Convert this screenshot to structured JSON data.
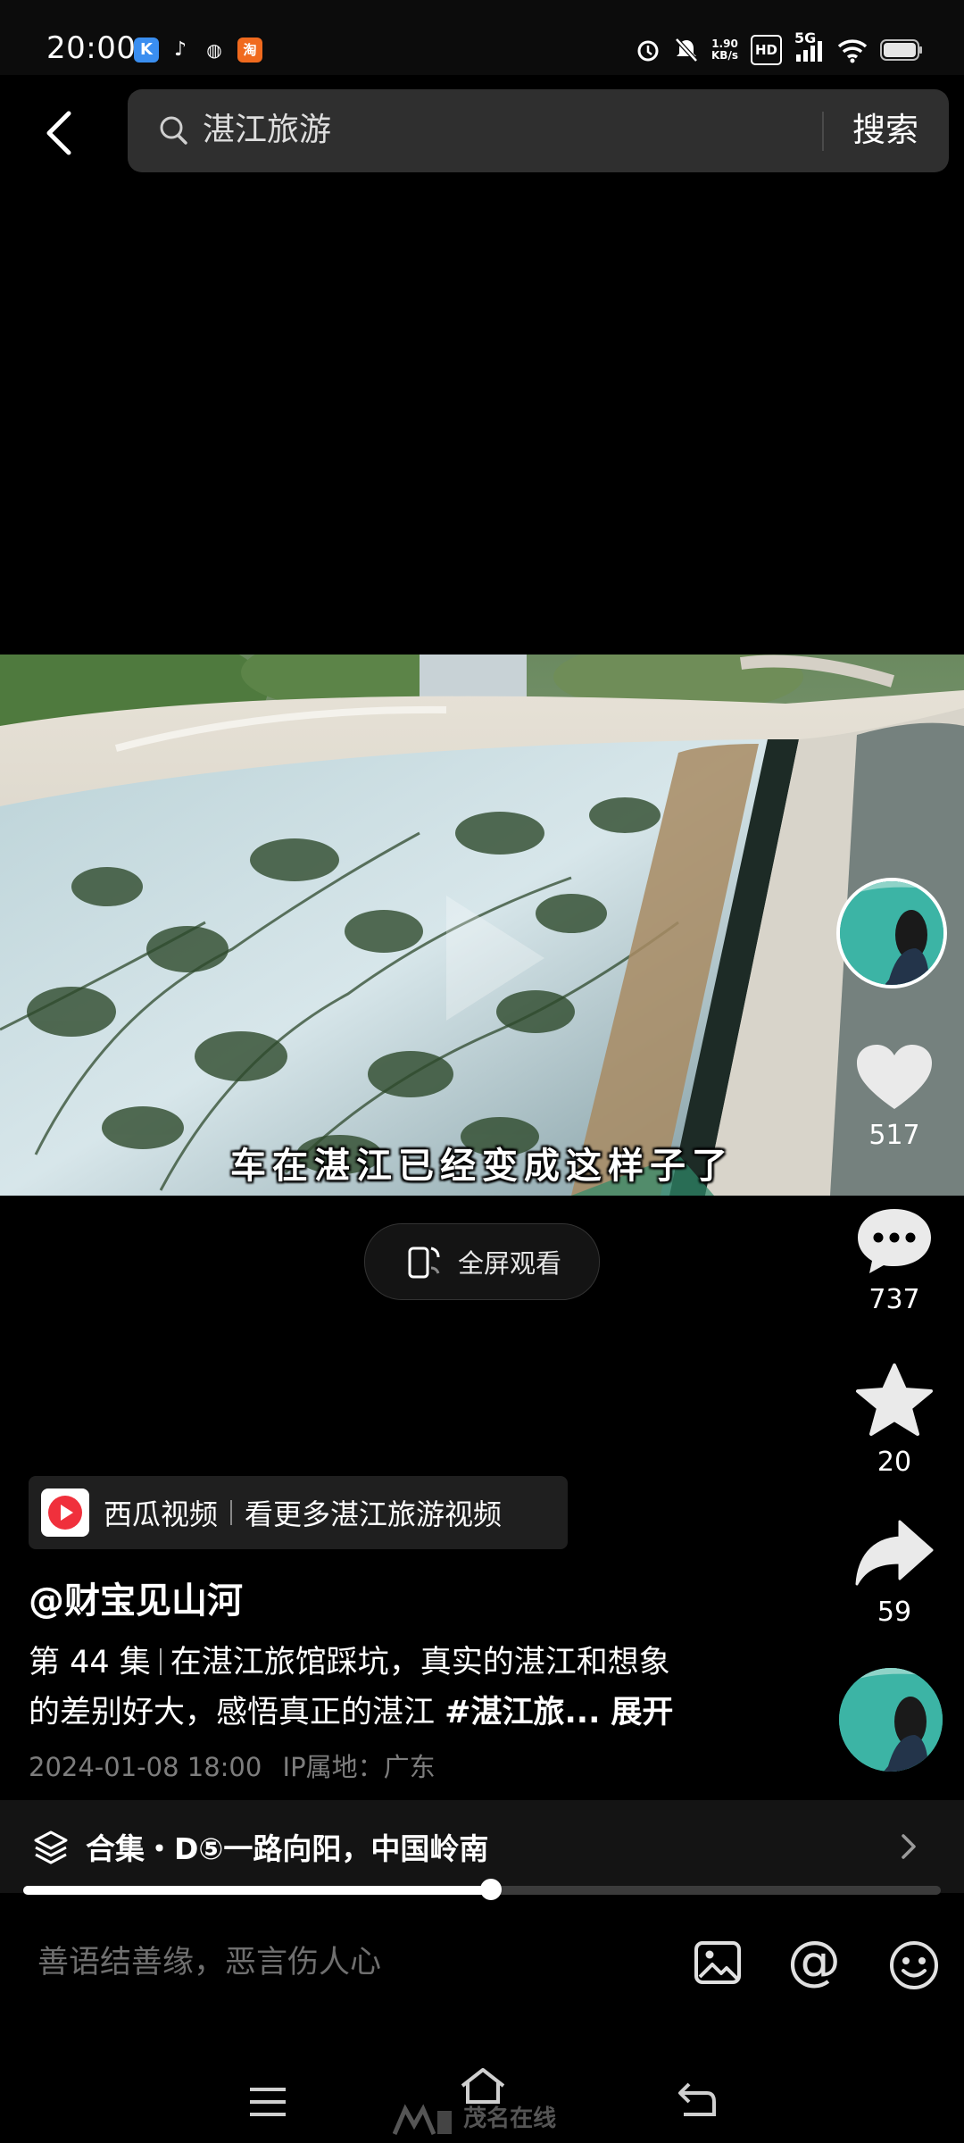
{
  "status_bar": {
    "time": "20:00",
    "net_speed_value": "1.90",
    "net_speed_unit": "KB/s",
    "hd_label": "HD",
    "network": "5G"
  },
  "header": {
    "search_query": "湛江旅游",
    "search_button_label": "搜索"
  },
  "video": {
    "subtitle": "车在湛江已经变成这样子了"
  },
  "fullscreen": {
    "label": "全屏观看"
  },
  "actions": {
    "like_count": "517",
    "comment_count": "737",
    "favorite_count": "20",
    "share_count": "59"
  },
  "xigua_banner": {
    "app_name": "西瓜视频",
    "cta": "看更多湛江旅游视频"
  },
  "post": {
    "author": "@财宝见山河",
    "episode": "第 44 集",
    "caption_line1": "在湛江旅馆踩坑，真实的湛江和想象",
    "caption_line2": "的差别好大，感悟真正的湛江",
    "hashtag": "#湛江旅...",
    "expand_label": "展开",
    "datetime": "2024-01-08 18:00",
    "ip_location": "IP属地：广东"
  },
  "collection": {
    "label": "合集・D⑤一路向阳，中国岭南"
  },
  "playback": {
    "progress": 0.51
  },
  "comment_bar": {
    "placeholder": "善语结善缘，恶言伤人心"
  },
  "watermark": {
    "text": "茂名在线"
  },
  "colors": {
    "background": "#000000",
    "search_box": "#2f2f2f",
    "xigua_red": "#f0303c",
    "muted_text": "#7d7d7d"
  }
}
